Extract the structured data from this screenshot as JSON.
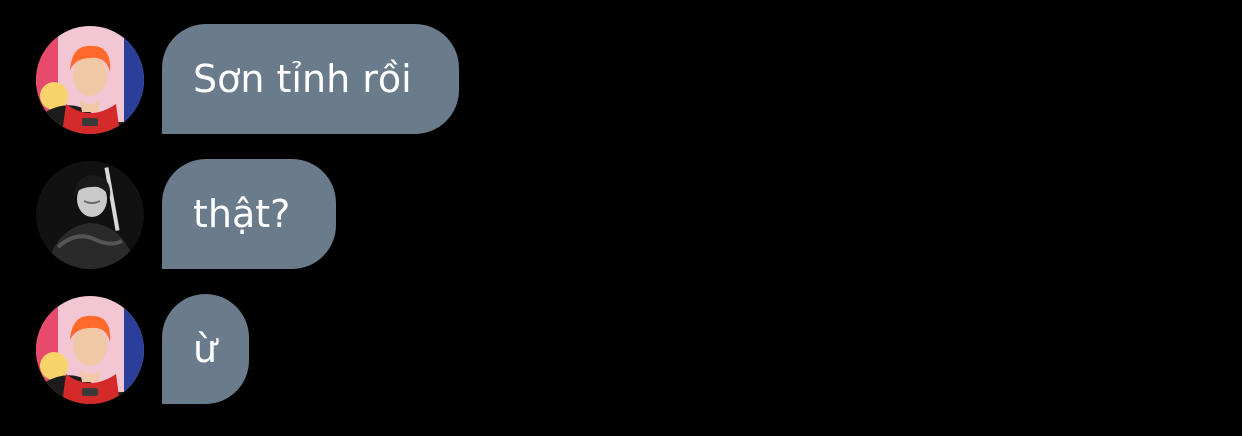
{
  "thread": {
    "messages": [
      {
        "sender_avatar": "avatar-orange-hair-icon",
        "text": "Sơn tỉnh rồi"
      },
      {
        "sender_avatar": "avatar-monochrome-icon",
        "text": "thật?"
      },
      {
        "sender_avatar": "avatar-orange-hair-icon",
        "text": "ừ"
      }
    ]
  },
  "colors": {
    "background": "#000000",
    "bubble": "#6a7b8b",
    "bubble_text": "#ffffff"
  }
}
